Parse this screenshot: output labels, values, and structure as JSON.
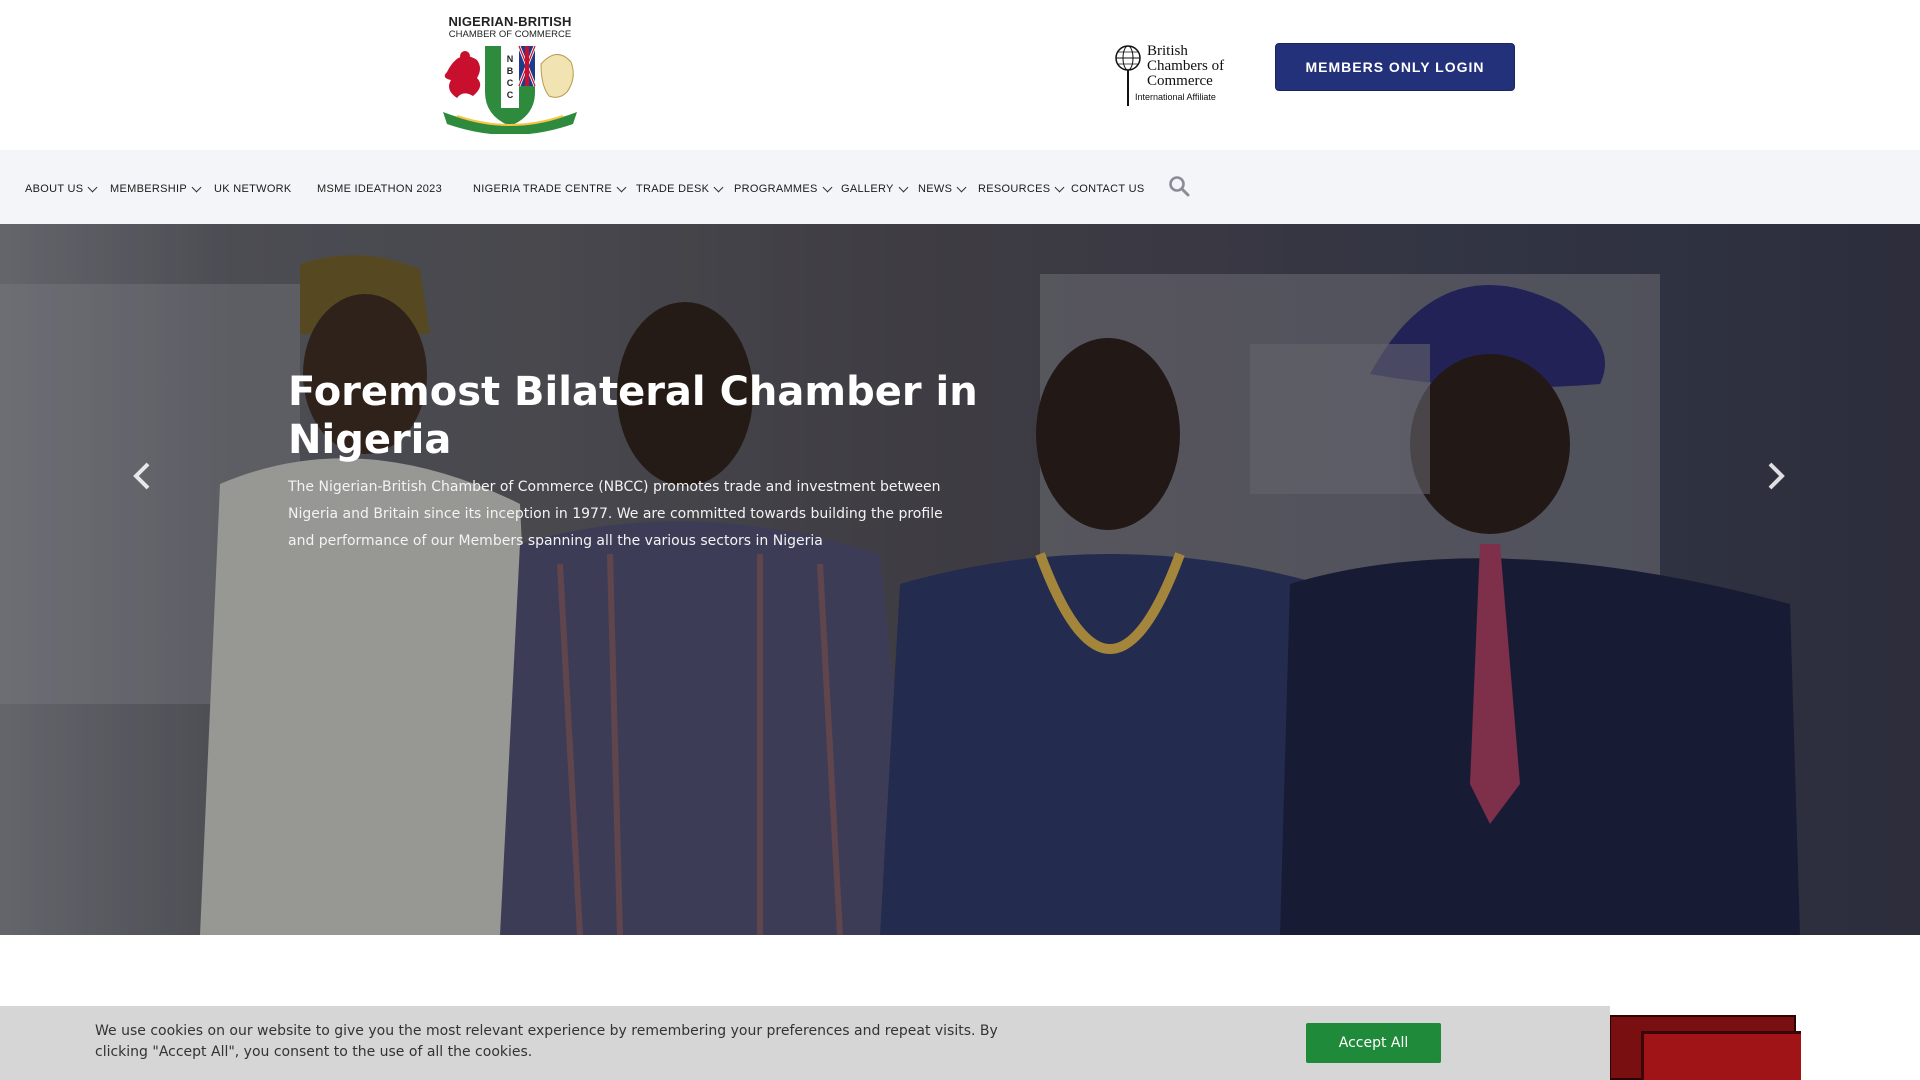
{
  "header": {
    "logo": {
      "title": "NIGERIAN-BRITISH",
      "subtitle": "CHAMBER OF COMMERCE",
      "shield_letters": "NBCC"
    },
    "affiliate": {
      "line1": "British",
      "line2": "Chambers of",
      "line3": "Commerce",
      "line4": "International Affiliate"
    },
    "login_label": "MEMBERS ONLY LOGIN"
  },
  "nav": {
    "items": [
      {
        "label": "ABOUT US",
        "dropdown": true
      },
      {
        "label": "MEMBERSHIP",
        "dropdown": true
      },
      {
        "label": "UK NETWORK",
        "dropdown": false
      },
      {
        "label": "MSME IDEATHON 2023",
        "dropdown": false
      },
      {
        "label": "NIGERIA TRADE CENTRE",
        "dropdown": true
      },
      {
        "label": "TRADE DESK",
        "dropdown": true
      },
      {
        "label": "PROGRAMMES",
        "dropdown": true
      },
      {
        "label": "GALLERY",
        "dropdown": true
      },
      {
        "label": "NEWS",
        "dropdown": true
      },
      {
        "label": "RESOURCES",
        "dropdown": true
      },
      {
        "label": "CONTACT US",
        "dropdown": false
      }
    ],
    "search_icon": "search-icon"
  },
  "hero": {
    "title": "Foremost Bilateral Chamber in Nigeria",
    "text": "The Nigerian-British Chamber of Commerce (NBCC) promotes trade and investment between Nigeria and Britain since its inception in 1977. We are committed towards building the profile and performance of our Members spanning all the various sectors in Nigeria",
    "prev_icon": "chevron-left-icon",
    "next_icon": "chevron-right-icon"
  },
  "cookie": {
    "text": "We use cookies on our website to give you the most relevant experience by remembering your preferences and repeat visits. By clicking \"Accept All\", you consent to the use of all the cookies.",
    "accept_label": "Accept All"
  },
  "colors": {
    "brand_navy": "#23307a",
    "accept_green": "#1f8a3a",
    "nav_bg": "#f4f5f8",
    "cookie_bg": "#d6d6d6"
  }
}
